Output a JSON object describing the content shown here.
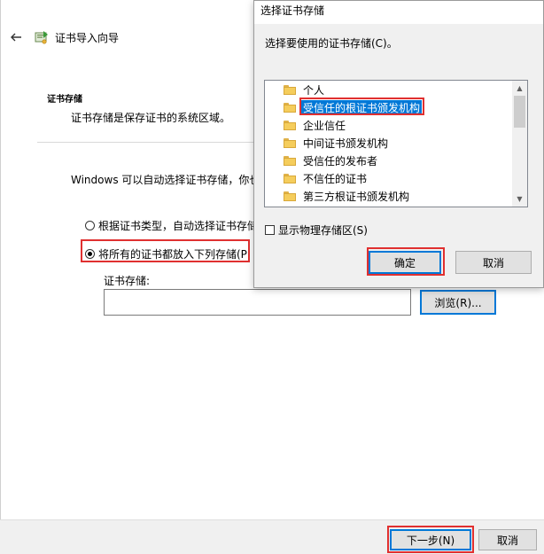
{
  "wizard": {
    "title": "证书导入向导",
    "section_title": "证书存储",
    "section_desc": "证书存储是保存证书的系统区域。",
    "auto_text": "Windows 可以自动选择证书存储，你也",
    "radio_auto_label": "根据证书类型，自动选择证书存储",
    "radio_manual_label": "将所有的证书都放入下列存储(P",
    "radio_selected": "manual",
    "store_label": "证书存储:",
    "store_value": "",
    "browse_label": "浏览(R)...",
    "next_label": "下一步(N)",
    "cancel_label": "取消"
  },
  "dialog": {
    "title": "选择证书存储",
    "prompt": "选择要使用的证书存储(C)。",
    "items": [
      {
        "label": "个人"
      },
      {
        "label": "受信任的根证书颁发机构"
      },
      {
        "label": "企业信任"
      },
      {
        "label": "中间证书颁发机构"
      },
      {
        "label": "受信任的发布者"
      },
      {
        "label": "不信任的证书"
      },
      {
        "label": "第三方根证书颁发机构"
      }
    ],
    "selected_item": "受信任的根证书颁发机构",
    "show_physical_label": "显示物理存储区(S)",
    "show_physical_checked": false,
    "ok_label": "确定",
    "cancel_label": "取消"
  },
  "colors": {
    "highlight": "#e03030",
    "accent": "#0078d7"
  }
}
